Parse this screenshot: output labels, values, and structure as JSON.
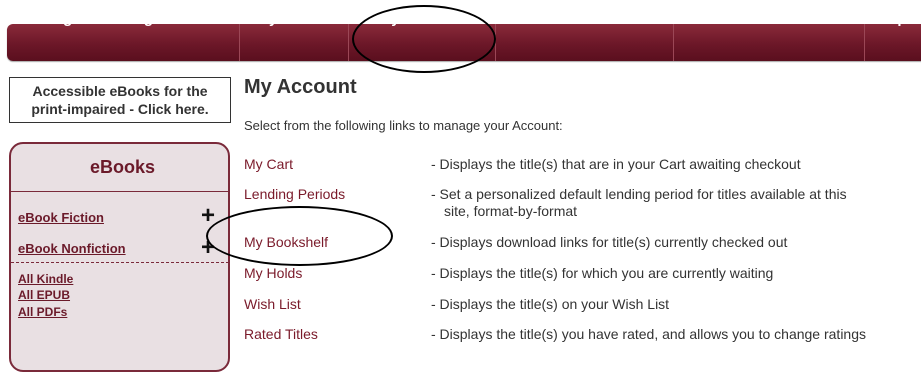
{
  "nav": {
    "items": [
      {
        "label": "Digital Catalog Home"
      },
      {
        "label": "My Cart"
      },
      {
        "label": "My Account"
      },
      {
        "label": "Advanced Search"
      },
      {
        "label": "Member Libraries"
      },
      {
        "label": "Help"
      }
    ]
  },
  "sidebar": {
    "accessible_line1": "Accessible eBooks for the",
    "accessible_line2": "print-impaired - Click here.",
    "panel_title": "eBooks",
    "plus_symbol": "+",
    "links": [
      {
        "label": "eBook Fiction"
      },
      {
        "label": "eBook Nonfiction"
      },
      {
        "label": "All Kindle"
      },
      {
        "label": "All EPUB"
      },
      {
        "label": "All PDFs"
      }
    ]
  },
  "main": {
    "title": "My Account",
    "intro": "Select from the following links to manage your Account:",
    "rows": [
      {
        "link": "My Cart",
        "desc": "-  Displays the title(s) that are in your Cart awaiting checkout"
      },
      {
        "link": "Lending Periods",
        "desc": "-  Set a personalized default lending period for titles available at this",
        "desc2": "site, format-by-format"
      },
      {
        "link": "My Bookshelf",
        "desc": "-  Displays download links for title(s) currently checked out"
      },
      {
        "link": "My Holds",
        "desc": "-  Displays the title(s) for which you are currently waiting"
      },
      {
        "link": "Wish List",
        "desc": "-  Displays the title(s) on your Wish List"
      },
      {
        "link": "Rated Titles",
        "desc": "-  Displays the title(s) you have rated, and allows you to change ratings"
      }
    ]
  },
  "colors": {
    "nav_bg": "#6c1728",
    "link": "#7a1a2a",
    "panel_bg": "#e9e0e3"
  }
}
